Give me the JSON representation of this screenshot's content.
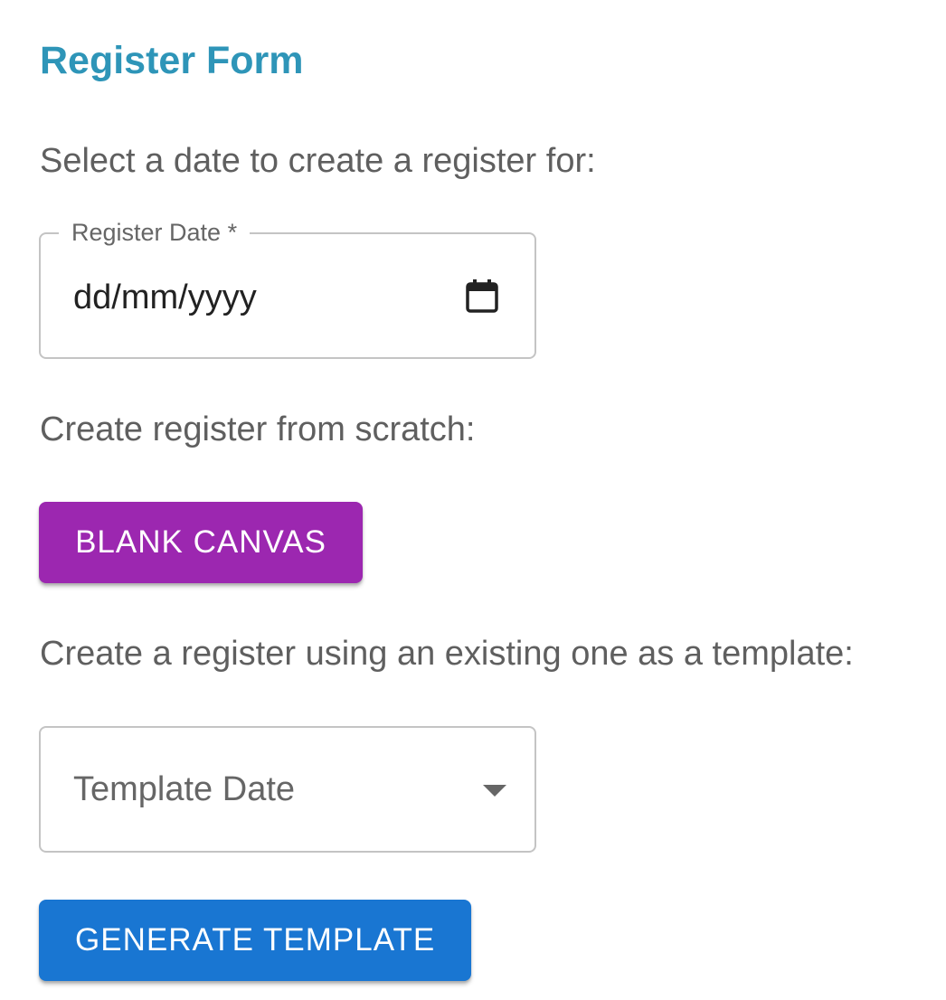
{
  "header": {
    "title": "Register Form"
  },
  "date_section": {
    "prompt": "Select a date to create a register for:",
    "field_label": "Register Date *",
    "field_value": "dd/mm/yyyy",
    "icon": "calendar-icon"
  },
  "scratch_section": {
    "prompt": "Create register from scratch:",
    "button_label": "BLANK CANVAS"
  },
  "template_section": {
    "prompt": "Create a register using an existing one as a template:",
    "select_placeholder": "Template Date",
    "icon": "chevron-down-icon",
    "button_label": "GENERATE TEMPLATE"
  },
  "colors": {
    "title": "#2e95b8",
    "text": "#5f5f5f",
    "blank_canvas_button": "#9c27b0",
    "generate_template_button": "#1976d2",
    "field_border": "#c4c4c4"
  }
}
